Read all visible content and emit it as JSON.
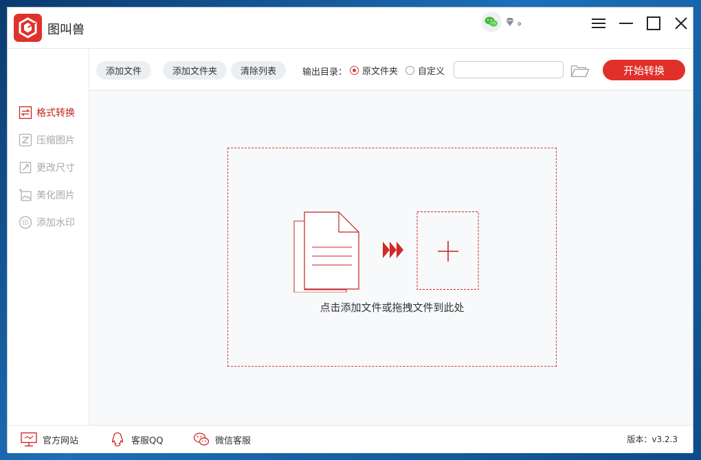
{
  "app": {
    "title": "图叫兽",
    "user_name": "。"
  },
  "toolbar": {
    "add_file": "添加文件",
    "add_folder": "添加文件夹",
    "clear_list": "清除列表",
    "output_label": "输出目录：",
    "radio_original": "原文件夹",
    "radio_custom": "自定义",
    "radio_selected": "原文件夹",
    "path_value": "",
    "start_button": "开始转换"
  },
  "sidebar": {
    "items": [
      {
        "label": "格式转换",
        "icon": "convert-icon",
        "active": true
      },
      {
        "label": "压缩图片",
        "icon": "compress-icon",
        "active": false
      },
      {
        "label": "更改尺寸",
        "icon": "resize-icon",
        "active": false
      },
      {
        "label": "美化图片",
        "icon": "beautify-icon",
        "active": false
      },
      {
        "label": "添加水印",
        "icon": "watermark-icon",
        "active": false
      }
    ]
  },
  "dropzone": {
    "hint": "点击添加文件或拖拽文件到此处"
  },
  "footer": {
    "website": "官方网站",
    "qq": "客服QQ",
    "wechat": "微信客服",
    "version": "版本：v3.2.3"
  },
  "colors": {
    "accent": "#e03029",
    "active_text": "#c4231e",
    "inactive_text": "#a8a8a8",
    "content_bg": "#f7f9fb"
  }
}
